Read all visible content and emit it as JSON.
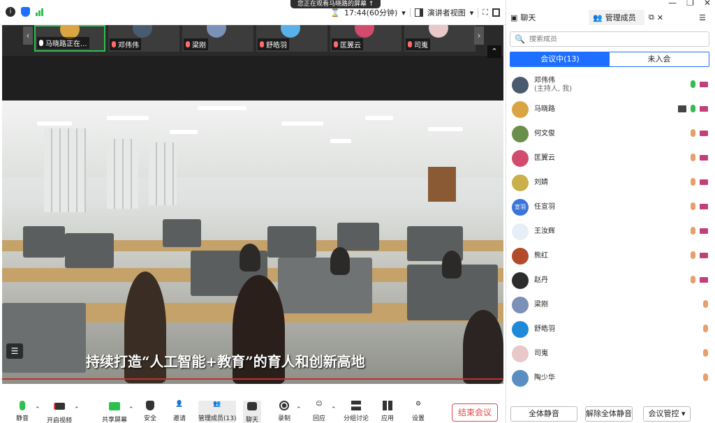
{
  "notice": "您正在观看马晓路的屏幕 ↑",
  "topbar": {
    "timer": "17:44(60分钟)",
    "view_label": "演讲者视图",
    "info_icon": "info-icon",
    "shield_icon": "shield-icon"
  },
  "thumbnails": [
    {
      "name": "马晓路正在...",
      "color": "#d9a441"
    },
    {
      "name": "邓伟伟",
      "color": "#4a5b70"
    },
    {
      "name": "梁刚",
      "color": "#7b91b8"
    },
    {
      "name": "舒皓羽",
      "color": "#5ab0e8"
    },
    {
      "name": "匡翼云",
      "color": "#d24a6e"
    },
    {
      "name": "司嵬",
      "color": "#e8c8c8"
    }
  ],
  "caption": "持续打造“人工智能+教育”的育人和创新高地",
  "toolbar": {
    "mute": "静音",
    "video": "开启视频",
    "share": "共享屏幕",
    "security": "安全",
    "invite": "邀请",
    "members": "管理成员(13)",
    "chat": "聊天",
    "record": "录制",
    "react": "回应",
    "breakout": "分组讨论",
    "apps": "应用",
    "settings": "设置",
    "end": "结束会议"
  },
  "panel": {
    "tab_chat": "聊天",
    "tab_members": "管理成员",
    "search_placeholder": "搜索成员",
    "seg_in": "会议中(13)",
    "seg_out": "未入会",
    "mute_all": "全体静音",
    "unmute_all": "解除全体静音",
    "control": "会议管控 ▾"
  },
  "members": [
    {
      "name": "邓伟伟",
      "sub": "(主持人, 我)",
      "color": "#4a5b70",
      "mic": "on",
      "cam": true,
      "screen": false
    },
    {
      "name": "马晓路",
      "sub": "",
      "color": "#d9a441",
      "mic": "on",
      "cam": true,
      "screen": true
    },
    {
      "name": "何文俊",
      "sub": "",
      "color": "#6a8f4a",
      "mic": "off",
      "cam": true,
      "screen": false
    },
    {
      "name": "匡翼云",
      "sub": "",
      "color": "#d24a6e",
      "mic": "off",
      "cam": true,
      "screen": false
    },
    {
      "name": "刘婧",
      "sub": "",
      "color": "#c9b04a",
      "mic": "off",
      "cam": true,
      "screen": false
    },
    {
      "name": "任宣羽",
      "sub": "",
      "color": "#3b74d8",
      "mic": "off",
      "cam": true,
      "screen": false,
      "initials": "宣羽"
    },
    {
      "name": "王汝辉",
      "sub": "",
      "color": "#e8eef5",
      "mic": "off",
      "cam": true,
      "screen": false
    },
    {
      "name": "熊红",
      "sub": "",
      "color": "#b34a2a",
      "mic": "off",
      "cam": true,
      "screen": false
    },
    {
      "name": "赵丹",
      "sub": "",
      "color": "#2c2c2c",
      "mic": "off",
      "cam": true,
      "screen": false
    },
    {
      "name": "梁刚",
      "sub": "",
      "color": "#7b91b8",
      "mic": "off",
      "cam": false,
      "screen": false
    },
    {
      "name": "舒皓羽",
      "sub": "",
      "color": "#1e8ad8",
      "mic": "off",
      "cam": false,
      "screen": false
    },
    {
      "name": "司嵬",
      "sub": "",
      "color": "#e8c8c8",
      "mic": "off",
      "cam": false,
      "screen": false
    },
    {
      "name": "陶少华",
      "sub": "",
      "color": "#5a8ec2",
      "mic": "off",
      "cam": false,
      "screen": false
    }
  ]
}
